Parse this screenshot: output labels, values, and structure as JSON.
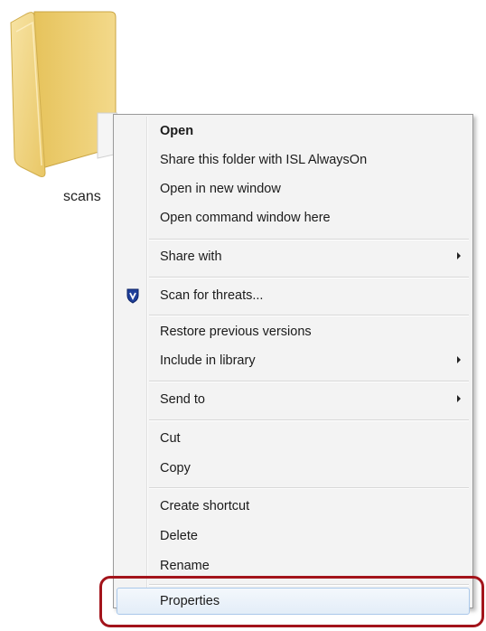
{
  "desktop": {
    "folder_label": "scans"
  },
  "context_menu": {
    "items": {
      "open": "Open",
      "share_this_folder": "Share this folder with ISL AlwaysOn",
      "open_new_window": "Open in new window",
      "open_command_window": "Open command window here",
      "share_with": "Share with",
      "scan_for_threats": "Scan for threats...",
      "restore_previous_versions": "Restore previous versions",
      "include_in_library": "Include in library",
      "send_to": "Send to",
      "cut": "Cut",
      "copy": "Copy",
      "create_shortcut": "Create shortcut",
      "delete": "Delete",
      "rename": "Rename",
      "properties": "Properties"
    },
    "icons": {
      "scan_for_threats": "shield-icon",
      "submenu": "chevron-right-icon"
    },
    "highlighted_item": "Properties",
    "highlight_color": "#a3141b"
  }
}
